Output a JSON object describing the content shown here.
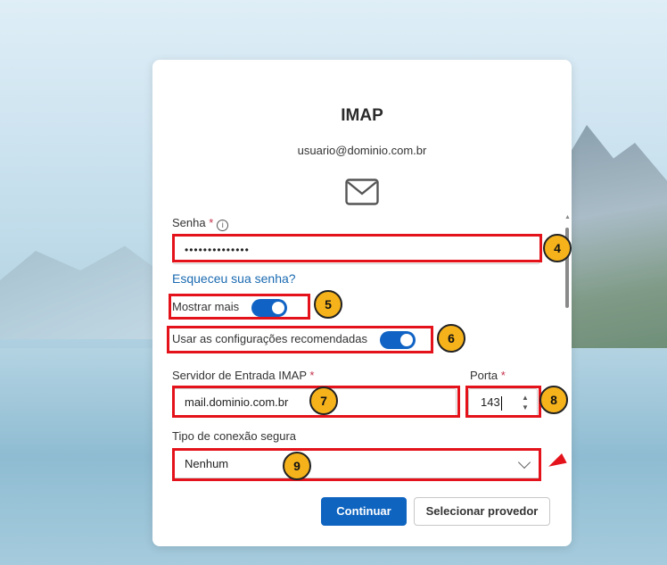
{
  "dialog": {
    "title": "IMAP",
    "email": "usuario@dominio.com.br",
    "icon": "mail-icon"
  },
  "password": {
    "label": "Senha",
    "required_mark": "*",
    "info_glyph": "i",
    "value": "••••••••••••••"
  },
  "forgot_link": "Esqueceu sua senha?",
  "show_more": {
    "label": "Mostrar mais",
    "on": true
  },
  "recommended": {
    "label": "Usar as configurações recomendadas",
    "on": true
  },
  "incoming_server": {
    "label": "Servidor de Entrada IMAP",
    "required_mark": "*",
    "value": "mail.dominio.com.br"
  },
  "port": {
    "label": "Porta",
    "required_mark": "*",
    "value": "143",
    "up_glyph": "▲",
    "down_glyph": "▼"
  },
  "security": {
    "label": "Tipo de conexão segura",
    "value": "Nenhum"
  },
  "buttons": {
    "continue": "Continuar",
    "select_provider": "Selecionar provedor"
  },
  "annotations": [
    "4",
    "5",
    "6",
    "7",
    "8",
    "9"
  ],
  "colors": {
    "accent": "#0f64c0",
    "highlight": "#e4131b",
    "badge": "#f5b21b",
    "link": "#1a6ab1"
  }
}
